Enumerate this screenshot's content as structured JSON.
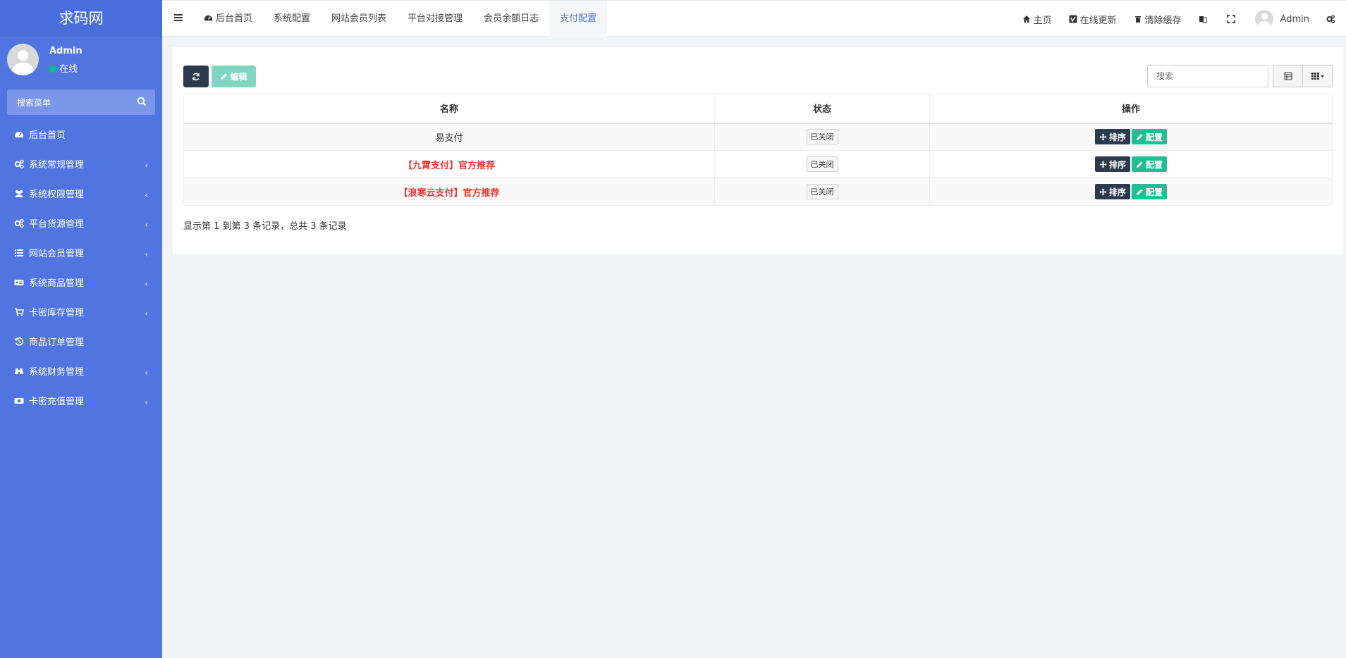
{
  "sidebar": {
    "logo": "求码网",
    "user": {
      "name": "Admin",
      "status": "在线"
    },
    "search_placeholder": "搜索菜单",
    "items": [
      {
        "label": "后台首页",
        "icon": "dashboard-icon",
        "has_children": false
      },
      {
        "label": "系统常规管理",
        "icon": "cogs-icon",
        "has_children": true
      },
      {
        "label": "系统权限管理",
        "icon": "users-icon",
        "has_children": true
      },
      {
        "label": "平台货源管理",
        "icon": "cogs-icon",
        "has_children": true
      },
      {
        "label": "网站会员管理",
        "icon": "list-icon",
        "has_children": true
      },
      {
        "label": "系统商品管理",
        "icon": "id-card-icon",
        "has_children": true
      },
      {
        "label": "卡密库存管理",
        "icon": "cart-icon",
        "has_children": true
      },
      {
        "label": "商品订单管理",
        "icon": "history-icon",
        "has_children": false
      },
      {
        "label": "系统财务管理",
        "icon": "binoculars-icon",
        "has_children": true
      },
      {
        "label": "卡密充值管理",
        "icon": "money-icon",
        "has_children": true
      }
    ]
  },
  "topbar": {
    "tabs": [
      {
        "label": "后台首页",
        "active": false,
        "icon": "dashboard-icon"
      },
      {
        "label": "系统配置",
        "active": false
      },
      {
        "label": "网站会员列表",
        "active": false
      },
      {
        "label": "平台对接管理",
        "active": false
      },
      {
        "label": "会员余额日志",
        "active": false
      },
      {
        "label": "支付配置",
        "active": true
      }
    ],
    "right": {
      "home": "主页",
      "update": "在线更新",
      "clear_cache": "清除缓存",
      "user": "Admin"
    }
  },
  "toolbar": {
    "edit_label": "编辑",
    "search_placeholder": "搜索"
  },
  "table": {
    "headers": [
      "名称",
      "状态",
      "操作"
    ],
    "rows": [
      {
        "name": "易支付",
        "highlight": false,
        "status": "已关闭",
        "sort": "排序",
        "config": "配置"
      },
      {
        "name": "【九霄支付】官方推荐",
        "highlight": true,
        "status": "已关闭",
        "sort": "排序",
        "config": "配置"
      },
      {
        "name": "【浪寒云支付】官方推荐",
        "highlight": true,
        "status": "已关闭",
        "sort": "排序",
        "config": "配置"
      }
    ],
    "summary": "显示第 1 到第 3 条记录，总共 3 条记录"
  },
  "colors": {
    "sidebar": "#5075e0",
    "primary_dark": "#2b3a4f",
    "success": "#1fbf93",
    "danger": "#e53935",
    "active_tab": "#5075e0"
  }
}
